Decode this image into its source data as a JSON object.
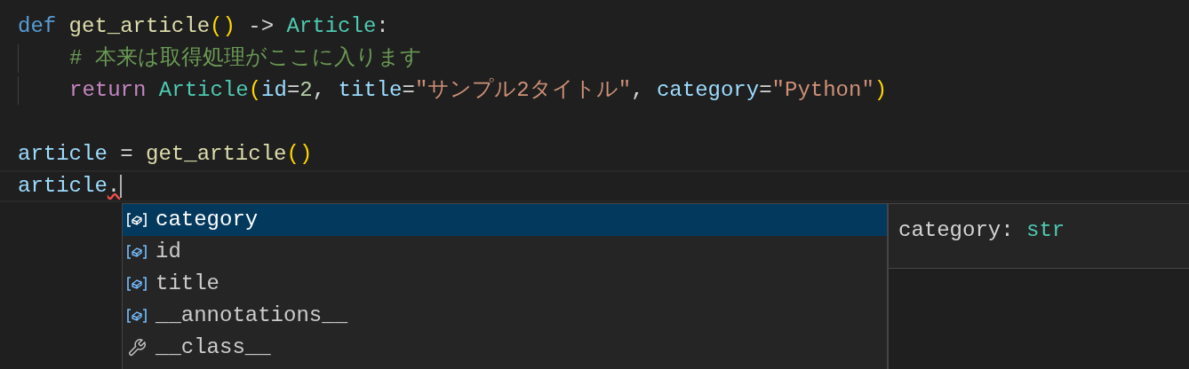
{
  "code_lines": [
    {
      "current": false,
      "indent": false,
      "tokens": [
        {
          "kind": "keyword",
          "text": "def "
        },
        {
          "kind": "function",
          "text": "get_article"
        },
        {
          "kind": "bracket",
          "text": "()"
        },
        {
          "kind": "plain",
          "text": " -> "
        },
        {
          "kind": "type",
          "text": "Article"
        },
        {
          "kind": "plain",
          "text": ":"
        }
      ]
    },
    {
      "current": false,
      "indent": true,
      "tokens": [
        {
          "kind": "comment",
          "text": "# 本来は取得処理がここに入ります"
        }
      ]
    },
    {
      "current": false,
      "indent": true,
      "tokens": [
        {
          "kind": "control",
          "text": "return "
        },
        {
          "kind": "type",
          "text": "Article"
        },
        {
          "kind": "bracket",
          "text": "("
        },
        {
          "kind": "param",
          "text": "id"
        },
        {
          "kind": "plain",
          "text": "="
        },
        {
          "kind": "number",
          "text": "2"
        },
        {
          "kind": "plain",
          "text": ", "
        },
        {
          "kind": "param",
          "text": "title"
        },
        {
          "kind": "plain",
          "text": "="
        },
        {
          "kind": "string",
          "text": "\"サンプル2タイトル\""
        },
        {
          "kind": "plain",
          "text": ", "
        },
        {
          "kind": "param",
          "text": "category"
        },
        {
          "kind": "plain",
          "text": "="
        },
        {
          "kind": "string",
          "text": "\"Python\""
        },
        {
          "kind": "bracket",
          "text": ")"
        }
      ]
    },
    {
      "current": false,
      "indent": false
    },
    {
      "current": false,
      "indent": false,
      "tokens": [
        {
          "kind": "variable",
          "text": "article"
        },
        {
          "kind": "plain",
          "text": " = "
        },
        {
          "kind": "function",
          "text": "get_article"
        },
        {
          "kind": "bracket",
          "text": "()"
        }
      ]
    },
    {
      "current": true,
      "indent": false,
      "tokens": [
        {
          "kind": "variable",
          "text": "article"
        },
        {
          "kind": "error",
          "text": "."
        }
      ]
    }
  ],
  "suggestions": [
    {
      "kind": "field",
      "label": "category",
      "selected": true
    },
    {
      "kind": "field",
      "label": "id",
      "selected": false
    },
    {
      "kind": "field",
      "label": "title",
      "selected": false
    },
    {
      "kind": "field",
      "label": "__annotations__",
      "selected": false
    },
    {
      "kind": "method",
      "label": "__class__",
      "selected": false
    }
  ],
  "details": {
    "tokens": [
      {
        "kind": "plain",
        "text": "category: "
      },
      {
        "kind": "type",
        "text": "str"
      }
    ]
  }
}
